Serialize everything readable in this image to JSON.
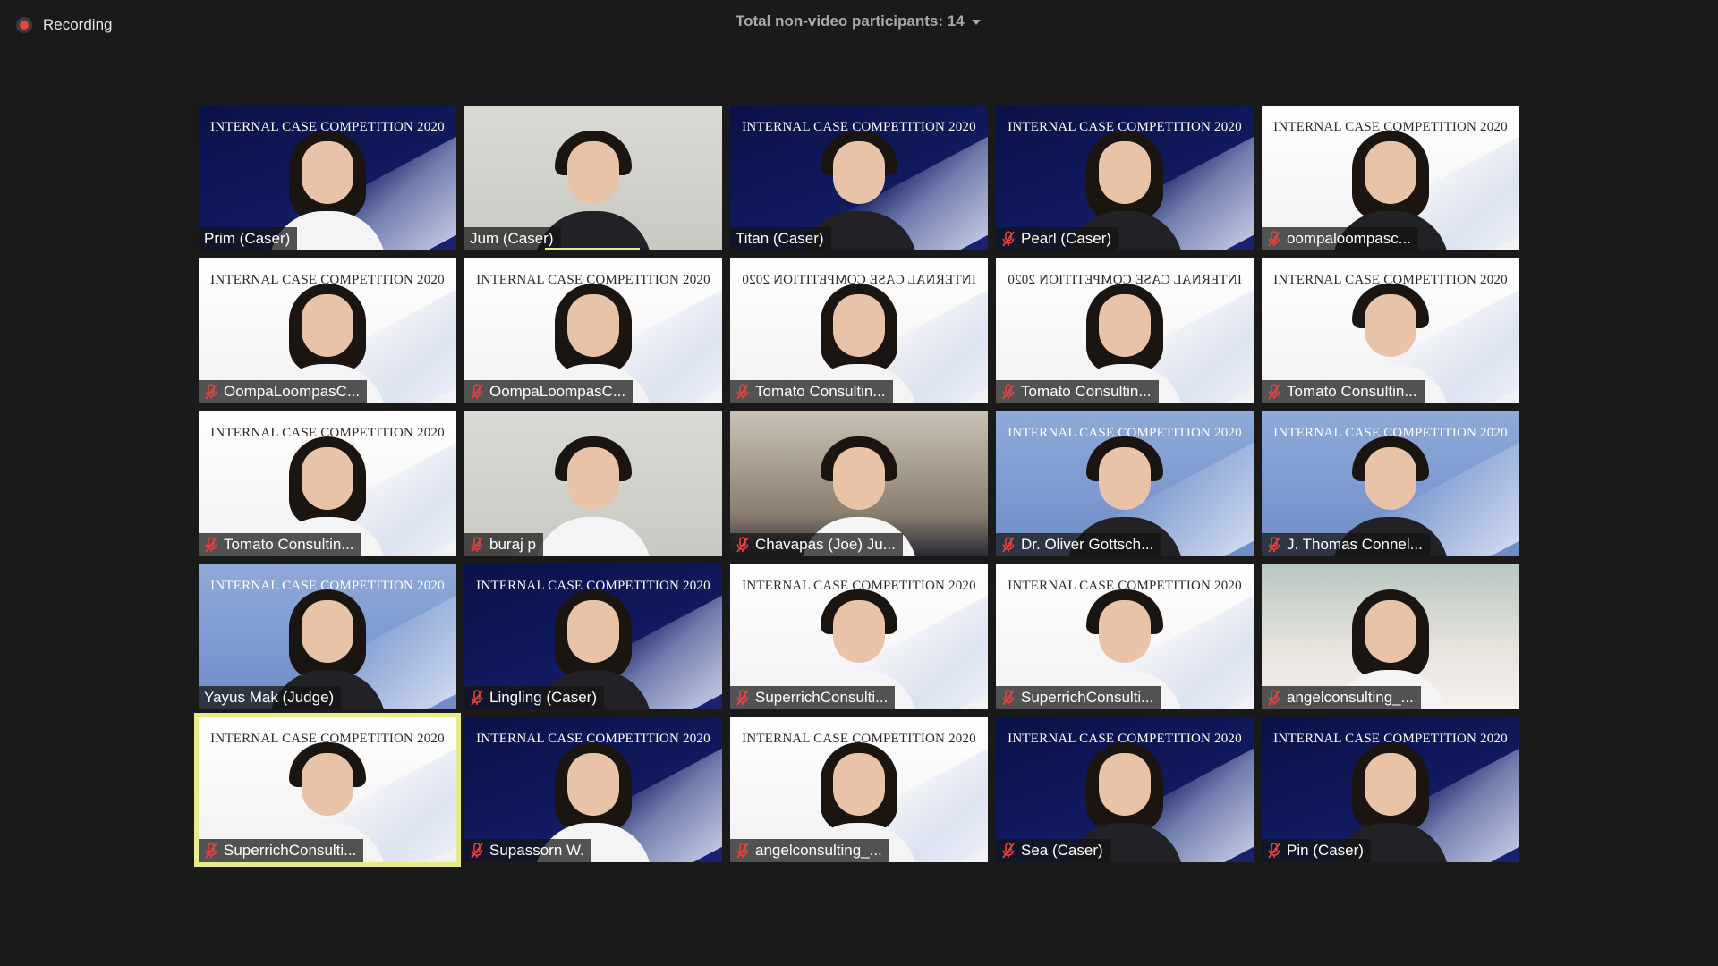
{
  "topbar": {
    "recording_label": "Recording",
    "nonvideo_label": "Total non-video participants: 14"
  },
  "colors": {
    "recording_dot": "#e8433f",
    "active_speaker_border": "#e7ec8a",
    "muted_icon": "#e8433f"
  },
  "participants": [
    {
      "name": "Prim (Caser)",
      "muted": false,
      "bg": "navy",
      "banner": "INTERNAL CASE COMPETITION 2020"
    },
    {
      "name": "Jum (Caser)",
      "muted": false,
      "bg": "grey",
      "banner": ""
    },
    {
      "name": "Titan (Caser)",
      "muted": false,
      "bg": "navy",
      "banner": "INTERNAL CASE COMPETITION 2020"
    },
    {
      "name": "Pearl (Caser)",
      "muted": true,
      "bg": "navy",
      "banner": "INTERNAL CASE COMPETITION 2020"
    },
    {
      "name": "oompaloompasc...",
      "muted": true,
      "bg": "white",
      "banner": "INTERNAL CASE COMPETITION 2020"
    },
    {
      "name": "OompaLoompasC...",
      "muted": true,
      "bg": "white",
      "banner": "INTERNAL CASE COMPETITION 2020"
    },
    {
      "name": "OompaLoompasC...",
      "muted": true,
      "bg": "white",
      "banner": "INTERNAL CASE COMPETITION 2020"
    },
    {
      "name": "Tomato Consultin...",
      "muted": true,
      "bg": "white",
      "banner": "INTERNAL CASE COMPETITION 2020",
      "mirrored": true
    },
    {
      "name": "Tomato Consultin...",
      "muted": true,
      "bg": "white",
      "banner": "INTERNAL CASE COMPETITION 2020",
      "mirrored": true
    },
    {
      "name": "Tomato Consultin...",
      "muted": true,
      "bg": "white",
      "banner": "INTERNAL CASE COMPETITION 2020"
    },
    {
      "name": "Tomato Consultin...",
      "muted": true,
      "bg": "white",
      "banner": "INTERNAL CASE COMPETITION 2020"
    },
    {
      "name": "buraj p",
      "muted": true,
      "bg": "grey",
      "banner": ""
    },
    {
      "name": "Chavapas (Joe) Ju...",
      "muted": true,
      "bg": "room",
      "banner": ""
    },
    {
      "name": "Dr. Oliver Gottsch...",
      "muted": true,
      "bg": "blue",
      "banner": "INTERNAL CASE COMPETITION 2020"
    },
    {
      "name": "J. Thomas Connel...",
      "muted": true,
      "bg": "blue",
      "banner": "INTERNAL CASE COMPETITION 2020"
    },
    {
      "name": "Yayus Mak (Judge)",
      "muted": false,
      "bg": "blue",
      "banner": "INTERNAL CASE COMPETITION 2020"
    },
    {
      "name": "Lingling (Caser)",
      "muted": true,
      "bg": "navy",
      "banner": "INTERNAL CASE COMPETITION 2020"
    },
    {
      "name": "SuperrichConsulti...",
      "muted": true,
      "bg": "white",
      "banner": "INTERNAL CASE COMPETITION 2020"
    },
    {
      "name": "SuperrichConsulti...",
      "muted": true,
      "bg": "white",
      "banner": "INTERNAL CASE COMPETITION 2020"
    },
    {
      "name": "angelconsulting_...",
      "muted": true,
      "bg": "photo",
      "banner": ""
    },
    {
      "name": "SuperrichConsulti...",
      "muted": true,
      "bg": "white",
      "banner": "INTERNAL CASE COMPETITION 2020",
      "active": true
    },
    {
      "name": "Supassorn W.",
      "muted": true,
      "bg": "navy",
      "banner": "INTERNAL CASE COMPETITION 2020"
    },
    {
      "name": "angelconsulting_...",
      "muted": true,
      "bg": "white",
      "banner": "INTERNAL CASE COMPETITION 2020"
    },
    {
      "name": "Sea (Caser)",
      "muted": true,
      "bg": "navy",
      "banner": "INTERNAL CASE COMPETITION 2020"
    },
    {
      "name": "Pin (Caser)",
      "muted": true,
      "bg": "navy",
      "banner": "INTERNAL CASE COMPETITION 2020"
    }
  ]
}
